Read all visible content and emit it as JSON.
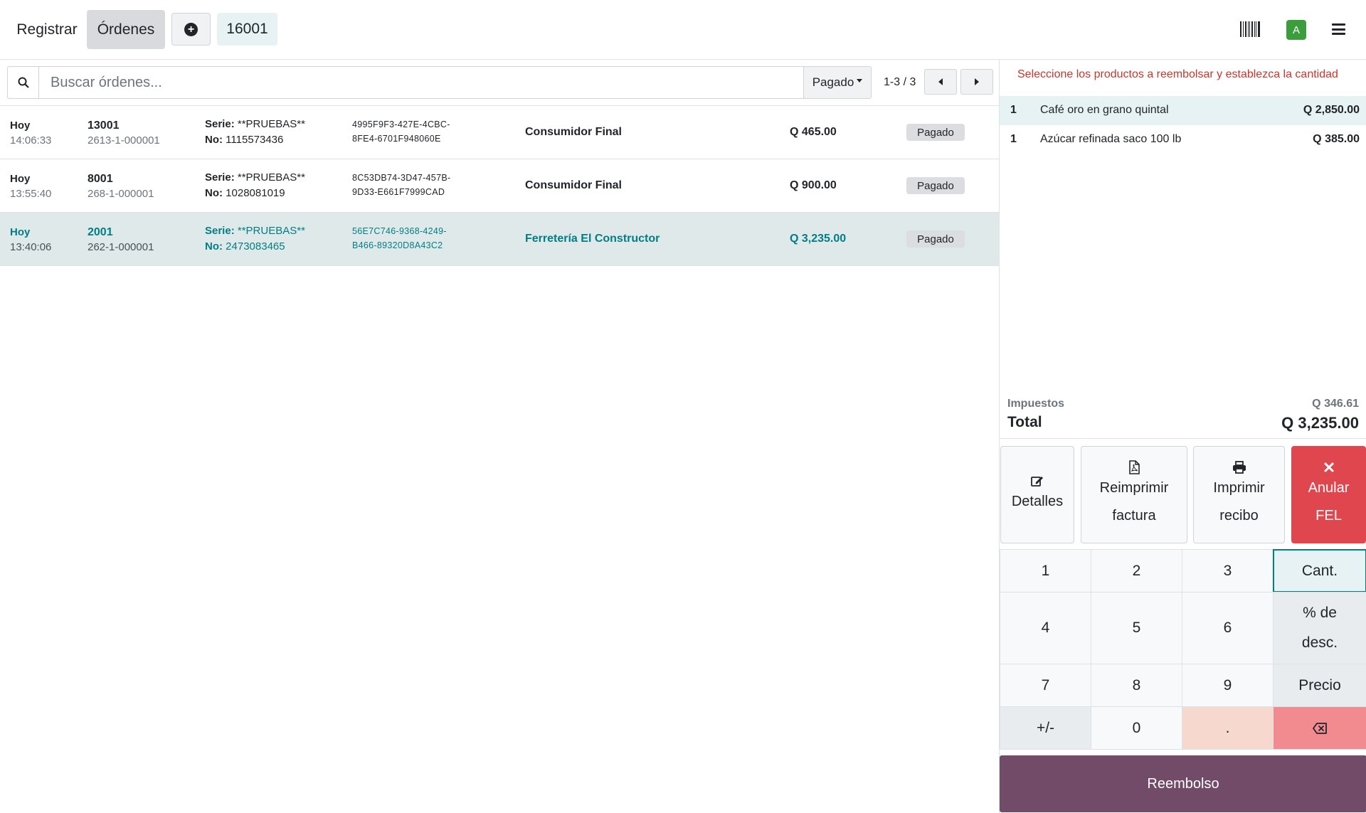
{
  "topbar": {
    "register_label": "Registrar",
    "orders_label": "Órdenes",
    "add_icon": "plus-circle-icon",
    "current_order": "16001",
    "avatar_letter": "A",
    "avatar_color": "#3c9d3c"
  },
  "search": {
    "placeholder": "Buscar órdenes...",
    "value": "",
    "filter_label": "Pagado",
    "pager_text": "1-3 / 3"
  },
  "orders": [
    {
      "day": "Hoy",
      "time": "14:06:33",
      "ref": "13001",
      "receipt": "2613-1-000001",
      "serie_label": "Serie:",
      "serie": "**PRUEBAS**",
      "no_label": "No:",
      "no": "1115573436",
      "uuid1": "4995F9F3-427E-4CBC-",
      "uuid2": "8FE4-6701F948060E",
      "customer": "Consumidor Final",
      "amount": "Q 465.00",
      "status": "Pagado"
    },
    {
      "day": "Hoy",
      "time": "13:55:40",
      "ref": "8001",
      "receipt": "268-1-000001",
      "serie_label": "Serie:",
      "serie": "**PRUEBAS**",
      "no_label": "No:",
      "no": "1028081019",
      "uuid1": "8C53DB74-3D47-457B-",
      "uuid2": "9D33-E661F7999CAD",
      "customer": "Consumidor Final",
      "amount": "Q 900.00",
      "status": "Pagado"
    },
    {
      "day": "Hoy",
      "time": "13:40:06",
      "ref": "2001",
      "receipt": "262-1-000001",
      "serie_label": "Serie:",
      "serie": "**PRUEBAS**",
      "no_label": "No:",
      "no": "2473083465",
      "uuid1": "56E7C746-9368-4249-",
      "uuid2": "B466-89320D8A43C2",
      "customer": "Ferretería El Constructor",
      "amount": "Q 3,235.00",
      "status": "Pagado"
    }
  ],
  "detail": {
    "refund_message": "Seleccione los productos a reembolsar y establezca la cantidad",
    "lines": [
      {
        "qty": "1",
        "name": "Café oro en grano quintal",
        "price": "Q 2,850.00"
      },
      {
        "qty": "1",
        "name": "Azúcar refinada saco 100 lb",
        "price": "Q 385.00"
      }
    ],
    "tax_label": "Impuestos",
    "tax_value": "Q 346.61",
    "total_label": "Total",
    "total_value": "Q 3,235.00"
  },
  "actions": {
    "details": "Detalles",
    "reprint_1": "Reimprimir",
    "reprint_2": "factura",
    "print_1": "Imprimir",
    "print_2": "recibo",
    "void_1": "Anular",
    "void_2": "FEL",
    "void_color": "#e0464e"
  },
  "numpad": {
    "k1": "1",
    "k2": "2",
    "k3": "3",
    "qty": "Cant.",
    "k4": "4",
    "k5": "5",
    "k6": "6",
    "disc_1": "% de",
    "disc_2": "desc.",
    "k7": "7",
    "k8": "8",
    "k9": "9",
    "price": "Precio",
    "sign": "+/-",
    "k0": "0",
    "dot": "."
  },
  "refund_button": "Reembolso",
  "colors": {
    "accent": "#017e84",
    "refund": "#714b67",
    "warning_text": "#c7362c"
  }
}
